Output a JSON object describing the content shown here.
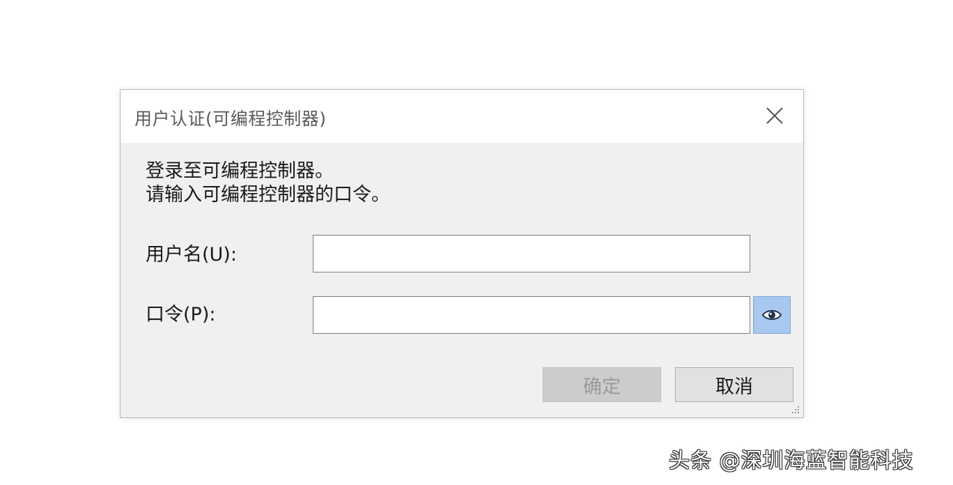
{
  "dialog": {
    "title": "用户认证(可编程控制器)",
    "close_icon": "close-icon",
    "message_line1": "登录至可编程控制器。",
    "message_line2": "请输入可编程控制器的口令。",
    "username": {
      "label": "用户名(U):",
      "value": ""
    },
    "password": {
      "label": "口令(P):",
      "value": "",
      "reveal_icon": "eye-icon"
    },
    "buttons": {
      "ok_label": "确定",
      "ok_disabled": true,
      "cancel_label": "取消"
    }
  },
  "watermark": {
    "text": "头条 @深圳海蓝智能科技"
  },
  "colors": {
    "eye_button_bg": "#a8c8f0",
    "dialog_body_bg": "#f0f0f0",
    "ok_disabled_bg": "#cccccc"
  }
}
